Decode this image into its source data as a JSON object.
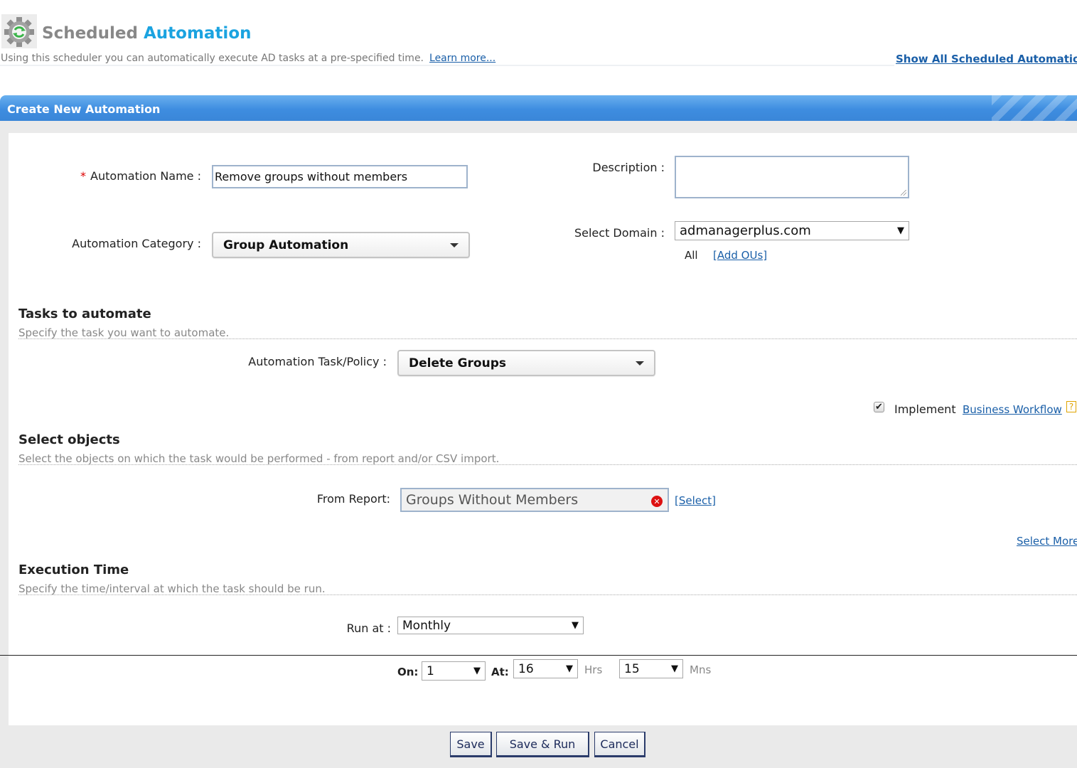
{
  "header": {
    "title_part1": "Scheduled",
    "title_part2": "Automation",
    "subtitle": "Using this scheduler you can automatically execute AD tasks at a pre-specified time.",
    "learn_more": "Learn more...",
    "show_all": "Show All Scheduled Automatio"
  },
  "panel": {
    "title": "Create New Automation"
  },
  "form": {
    "automation_name_label": "Automation Name :",
    "required_mark": "*",
    "automation_name_value": "Remove groups without members",
    "description_label": "Description :",
    "description_value": "",
    "category_label": "Automation Category :",
    "category_value": "Group Automation",
    "domain_label": "Select Domain :",
    "domain_value": "admanagerplus.com",
    "ou_all": "All",
    "add_ous": "[Add OUs]"
  },
  "tasks": {
    "heading": "Tasks to automate",
    "description": "Specify the task you want to automate.",
    "task_label": "Automation Task/Policy :",
    "task_value": "Delete Groups",
    "implement_label": "Implement",
    "workflow_link": "Business Workflow",
    "implement_checked": true
  },
  "objects": {
    "heading": "Select objects",
    "description": "Select the objects on which the task would be performed - from report and/or CSV import.",
    "from_report_label": "From Report:",
    "report_value": "Groups Without Members",
    "select_link": "[Select]",
    "select_more": "Select More"
  },
  "execution": {
    "heading": "Execution Time",
    "description": "Specify the time/interval at which the task should be run.",
    "run_at_label": "Run at :",
    "run_at_value": "Monthly",
    "on_label": "On:",
    "on_value": "1",
    "at_label": "At:",
    "hours_value": "16",
    "hours_unit": "Hrs",
    "minutes_value": "15",
    "minutes_unit": "Mns"
  },
  "buttons": {
    "save": "Save",
    "save_run": "Save & Run",
    "cancel": "Cancel"
  },
  "icons": {
    "app": "gear-recycle-icon",
    "dropdown": "triangle-down-icon",
    "clear": "close-circle-icon",
    "help": "help-icon"
  },
  "colors": {
    "title_accent": "#1ba3e0",
    "panel_header": "#3e8de0",
    "link": "#1a5fa8",
    "required": "#dd0000"
  }
}
